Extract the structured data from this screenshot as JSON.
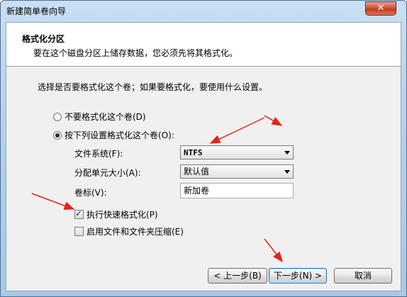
{
  "window": {
    "title": "新建简单卷向导",
    "close_glyph": "✕"
  },
  "header": {
    "title": "格式化分区",
    "subtitle": "要在这个磁盘分区上储存数据，您必须先将其格式化。"
  },
  "description": "选择是否要格式化这个卷；如果要格式化，要使用什么设置。",
  "options": {
    "no_format": {
      "label": "不要格式化这个卷(D)",
      "checked": false
    },
    "format": {
      "label": "按下列设置格式化这个卷(O):",
      "checked": true
    }
  },
  "fields": {
    "file_system": {
      "label": "文件系统(F):",
      "value": "NTFS"
    },
    "allocation_unit": {
      "label": "分配单元大小(A):",
      "value": "默认值"
    },
    "volume_label": {
      "label": "卷标(V):",
      "value": "新加卷"
    }
  },
  "checkboxes": {
    "quick_format": {
      "label": "执行快速格式化(P)",
      "checked": true
    },
    "compression": {
      "label": "启用文件和文件夹压缩(E)",
      "checked": false
    }
  },
  "buttons": {
    "back": "< 上一步(B)",
    "next": "下一步(N) >",
    "cancel": "取消"
  },
  "colors": {
    "annotation_arrow": "#e3241b",
    "title_bar": "#b5d1ec",
    "close_button": "#c2391f"
  }
}
